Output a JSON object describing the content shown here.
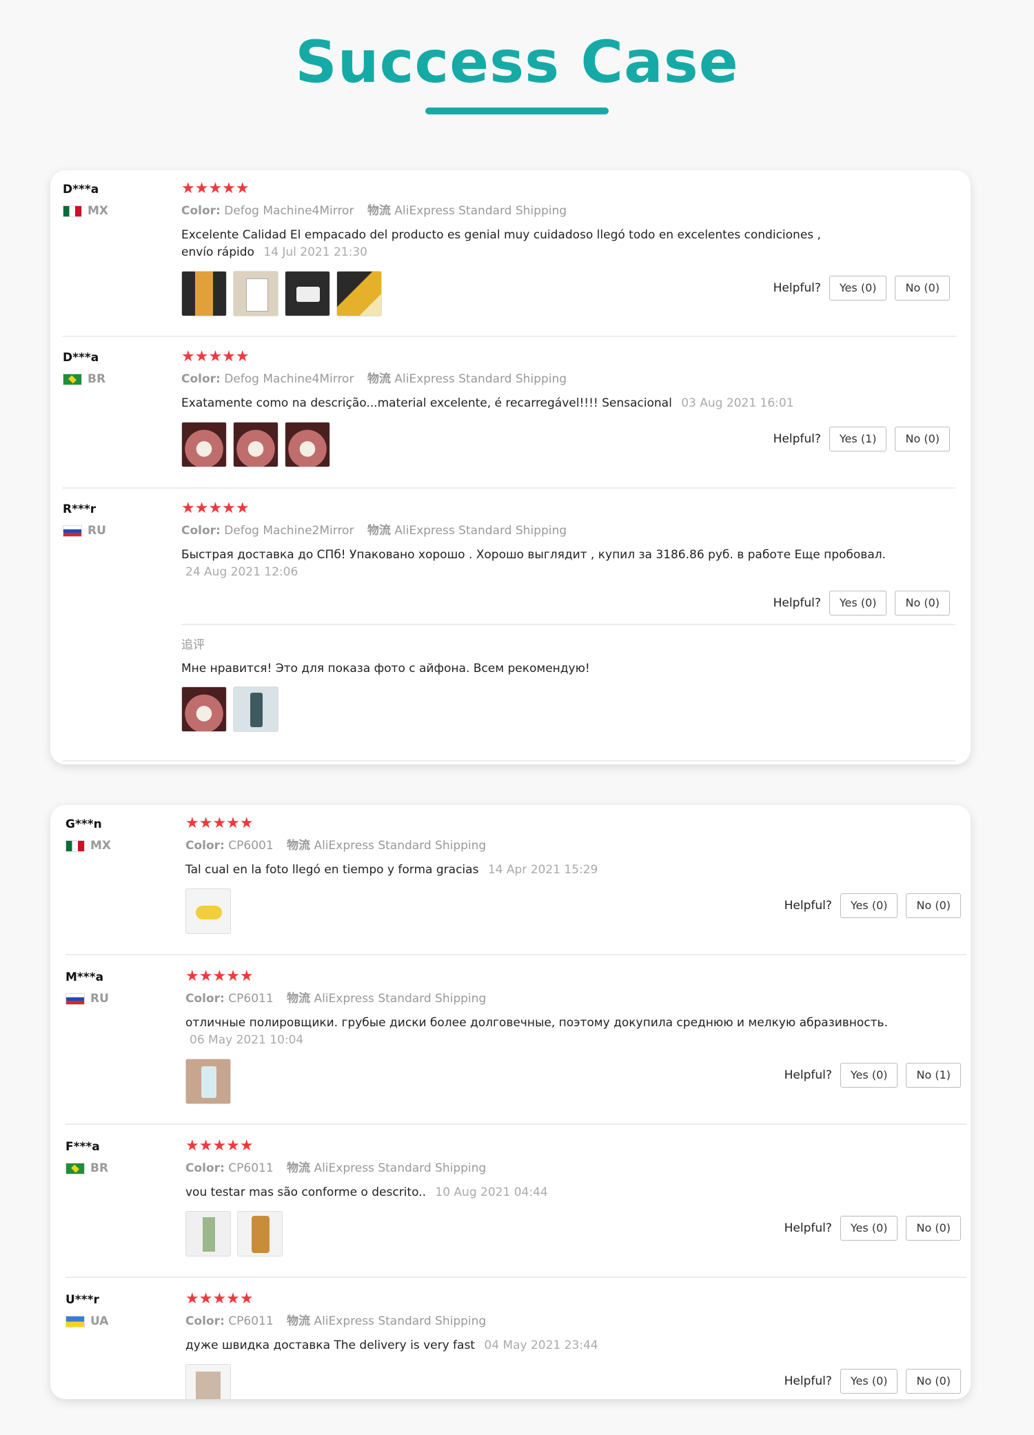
{
  "header": {
    "title": "Success Case"
  },
  "helpful_label": "Helpful?",
  "card1": {
    "reviews": [
      {
        "user": "D***a",
        "country": "MX",
        "stars": "★★★★★",
        "color_label": "Color:",
        "color_value": "Defog Machine4Mirror",
        "shipping_label": "物流",
        "shipping_value": "AliExpress Standard Shipping",
        "text": "Excelente Calidad El empacado del producto es genial muy cuidadoso llegó todo en excelentes condiciones , envío rápido",
        "date": "14 Jul 2021 21:30",
        "yes": "Yes (0)",
        "no": "No (0)"
      },
      {
        "user": "D***a",
        "country": "BR",
        "stars": "★★★★★",
        "color_label": "Color:",
        "color_value": "Defog Machine4Mirror",
        "shipping_label": "物流",
        "shipping_value": "AliExpress Standard Shipping",
        "text": "Exatamente como na descrição...material excelente, é recarregável!!!! Sensacional",
        "date": "03 Aug 2021 16:01",
        "yes": "Yes (1)",
        "no": "No (0)"
      },
      {
        "user": "R***r",
        "country": "RU",
        "stars": "★★★★★",
        "color_label": "Color:",
        "color_value": "Defog Machine2Mirror",
        "shipping_label": "物流",
        "shipping_value": "AliExpress Standard Shipping",
        "text": "Быстрая доставка до СПб! Упаковано хорошо . Хорошо выглядит , купил за 3186.86 руб. в работе Еще пробовал.",
        "date": "24 Aug 2021 12:06",
        "yes": "Yes (0)",
        "no": "No (0)",
        "followup_label": "追评",
        "followup_text": "Мне нравится! Это для показа фото с айфона. Всем рекомендую!"
      }
    ]
  },
  "card2": {
    "reviews": [
      {
        "user": "G***n",
        "country": "MX",
        "stars": "★★★★★",
        "color_label": "Color:",
        "color_value": "CP6001",
        "shipping_label": "物流",
        "shipping_value": "AliExpress Standard Shipping",
        "text": "Tal cual en la foto llegó en tiempo y forma gracias",
        "date": "14 Apr 2021 15:29",
        "yes": "Yes (0)",
        "no": "No (0)"
      },
      {
        "user": "M***a",
        "country": "RU",
        "stars": "★★★★★",
        "color_label": "Color:",
        "color_value": "CP6011",
        "shipping_label": "物流",
        "shipping_value": "AliExpress Standard Shipping",
        "text": "отличные полировщики. грубые диски более долговечные, поэтому докупила среднюю и мелкую абразивность.",
        "date": "06 May 2021 10:04",
        "yes": "Yes (0)",
        "no": "No (1)"
      },
      {
        "user": "F***a",
        "country": "BR",
        "stars": "★★★★★",
        "color_label": "Color:",
        "color_value": "CP6011",
        "shipping_label": "物流",
        "shipping_value": "AliExpress Standard Shipping",
        "text": "vou testar mas são conforme o descrito..",
        "date": "10 Aug 2021 04:44",
        "yes": "Yes (0)",
        "no": "No (0)"
      },
      {
        "user": "U***r",
        "country": "UA",
        "stars": "★★★★★",
        "color_label": "Color:",
        "color_value": "CP6011",
        "shipping_label": "物流",
        "shipping_value": "AliExpress Standard Shipping",
        "text": "дуже швидка доставка The delivery is very fast",
        "date": "04 May 2021 23:44",
        "yes": "Yes (0)",
        "no": "No (0)"
      }
    ]
  }
}
